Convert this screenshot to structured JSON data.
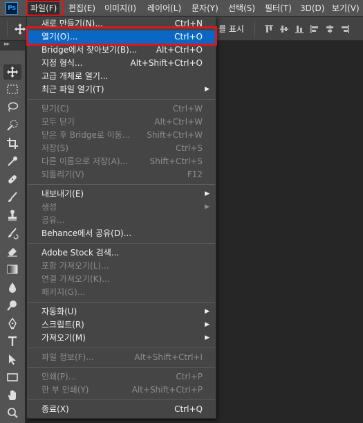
{
  "app": {
    "logo_text": "Ps"
  },
  "menubar": {
    "items": [
      "파일(F)",
      "편집(E)",
      "이미지(I)",
      "레이어(L)",
      "문자(Y)",
      "선택(S)",
      "필터(T)",
      "3D(D)",
      "보기(V)"
    ],
    "active_index": 0
  },
  "options_bar": {
    "show_controls": "를 표시"
  },
  "file_menu": {
    "items": [
      {
        "label": "새로 만들기(N)...",
        "shortcut": "Ctrl+N",
        "disabled": false,
        "submenu": false
      },
      {
        "label": "열기(O)...",
        "shortcut": "Ctrl+O",
        "disabled": false,
        "submenu": false,
        "highlighted": true
      },
      {
        "label": "Bridge에서 찾아보기(B)...",
        "shortcut": "Alt+Ctrl+O",
        "disabled": false,
        "submenu": false
      },
      {
        "label": "지정 형식...",
        "shortcut": "Alt+Shift+Ctrl+O",
        "disabled": false,
        "submenu": false
      },
      {
        "label": "고급 개체로 열기...",
        "shortcut": "",
        "disabled": false,
        "submenu": false
      },
      {
        "label": "최근 파일 열기(T)",
        "shortcut": "",
        "disabled": false,
        "submenu": true
      },
      {
        "label": "닫기(C)",
        "shortcut": "Ctrl+W",
        "disabled": true,
        "submenu": false
      },
      {
        "label": "모두 닫기",
        "shortcut": "Alt+Ctrl+W",
        "disabled": true,
        "submenu": false
      },
      {
        "label": "닫은 후 Bridge로 이동...",
        "shortcut": "Shift+Ctrl+W",
        "disabled": true,
        "submenu": false
      },
      {
        "label": "저장(S)",
        "shortcut": "Ctrl+S",
        "disabled": true,
        "submenu": false
      },
      {
        "label": "다른 이름으로 저장(A)...",
        "shortcut": "Shift+Ctrl+S",
        "disabled": true,
        "submenu": false
      },
      {
        "label": "되돌리기(V)",
        "shortcut": "F12",
        "disabled": true,
        "submenu": false
      },
      {
        "label": "내보내기(E)",
        "shortcut": "",
        "disabled": false,
        "submenu": true
      },
      {
        "label": "생성",
        "shortcut": "",
        "disabled": true,
        "submenu": true
      },
      {
        "label": "공유...",
        "shortcut": "",
        "disabled": true,
        "submenu": false
      },
      {
        "label": "Behance에서 공유(D)...",
        "shortcut": "",
        "disabled": false,
        "submenu": false
      },
      {
        "label": "Adobe Stock 검색...",
        "shortcut": "",
        "disabled": false,
        "submenu": false
      },
      {
        "label": "포함 가져오기(L)...",
        "shortcut": "",
        "disabled": true,
        "submenu": false
      },
      {
        "label": "연결 가져오기(K)...",
        "shortcut": "",
        "disabled": true,
        "submenu": false
      },
      {
        "label": "패키지(G)...",
        "shortcut": "",
        "disabled": true,
        "submenu": false
      },
      {
        "label": "자동화(U)",
        "shortcut": "",
        "disabled": false,
        "submenu": true
      },
      {
        "label": "스크립트(R)",
        "shortcut": "",
        "disabled": false,
        "submenu": true
      },
      {
        "label": "가져오기(M)",
        "shortcut": "",
        "disabled": false,
        "submenu": true
      },
      {
        "label": "파일 정보(F)...",
        "shortcut": "Alt+Shift+Ctrl+I",
        "disabled": true,
        "submenu": false
      },
      {
        "label": "인쇄(P)...",
        "shortcut": "Ctrl+P",
        "disabled": true,
        "submenu": false
      },
      {
        "label": "한 부 인쇄(Y)",
        "shortcut": "Alt+Shift+Ctrl+P",
        "disabled": true,
        "submenu": false
      },
      {
        "label": "종료(X)",
        "shortcut": "Ctrl+Q",
        "disabled": false,
        "submenu": false
      }
    ]
  },
  "toolbar": {
    "tools": [
      "move-tool",
      "marquee-tool",
      "lasso-tool",
      "quick-selection-tool",
      "crop-tool",
      "eyedropper-tool",
      "healing-brush-tool",
      "brush-tool",
      "clone-stamp-tool",
      "history-brush-tool",
      "eraser-tool",
      "gradient-tool",
      "blur-tool",
      "dodge-tool",
      "pen-tool",
      "type-tool",
      "path-selection-tool",
      "rectangle-tool",
      "hand-tool",
      "zoom-tool"
    ],
    "selected": "move-tool"
  },
  "colors": {
    "highlight": "#0a68c4",
    "annotation": "#e0161d",
    "menu_bg": "#454545",
    "disabled_text": "#8d8d8d"
  }
}
